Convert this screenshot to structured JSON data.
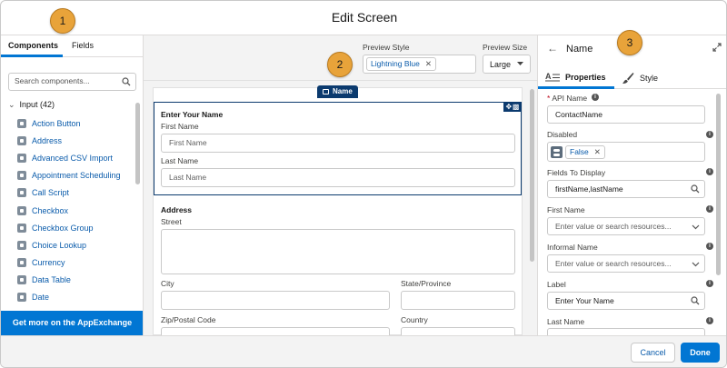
{
  "header": {
    "title": "Edit Screen"
  },
  "callouts": [
    "1",
    "2",
    "3"
  ],
  "left_panel": {
    "tabs": [
      {
        "label": "Components"
      },
      {
        "label": "Fields"
      }
    ],
    "search_placeholder": "Search components...",
    "category_label": "Input (42)",
    "items": [
      {
        "label": "Action Button"
      },
      {
        "label": "Address"
      },
      {
        "label": "Advanced CSV Import"
      },
      {
        "label": "Appointment Scheduling"
      },
      {
        "label": "Call Script"
      },
      {
        "label": "Checkbox"
      },
      {
        "label": "Checkbox Group"
      },
      {
        "label": "Choice Lookup"
      },
      {
        "label": "Currency"
      },
      {
        "label": "Data Table"
      },
      {
        "label": "Date"
      }
    ],
    "appexchange_label": "Get more on the AppExchange"
  },
  "preview": {
    "style_label": "Preview Style",
    "style_value": "Lightning Blue",
    "size_label": "Preview Size",
    "size_value": "Large"
  },
  "canvas": {
    "component_tag": "Name",
    "name_section": {
      "title": "Enter Your Name",
      "first_label": "First Name",
      "first_placeholder": "First Name",
      "last_label": "Last Name",
      "last_placeholder": "Last Name"
    },
    "address_section": {
      "title": "Address",
      "street_label": "Street",
      "city_label": "City",
      "state_label": "State/Province",
      "zip_label": "Zip/Postal Code",
      "country_label": "Country"
    }
  },
  "right_panel": {
    "title": "Name",
    "tabs": [
      {
        "label": "Properties"
      },
      {
        "label": "Style"
      }
    ],
    "fields": {
      "api_name_label": "API Name",
      "api_name_value": "ContactName",
      "disabled_label": "Disabled",
      "disabled_value": "False",
      "fields_to_display_label": "Fields To Display",
      "fields_to_display_value": "firstName,lastName",
      "first_name_label": "First Name",
      "first_name_placeholder": "Enter value or search resources...",
      "informal_name_label": "Informal Name",
      "informal_name_placeholder": "Enter value or search resources...",
      "label_label": "Label",
      "label_value": "Enter Your Name",
      "last_name_label": "Last Name"
    }
  },
  "footer": {
    "cancel_label": "Cancel",
    "done_label": "Done"
  },
  "colors": {
    "brand_blue": "#0176d3",
    "link_blue": "#0b5cab",
    "callout_orange": "#e8a33a",
    "selection_navy": "#0b3a6e"
  }
}
